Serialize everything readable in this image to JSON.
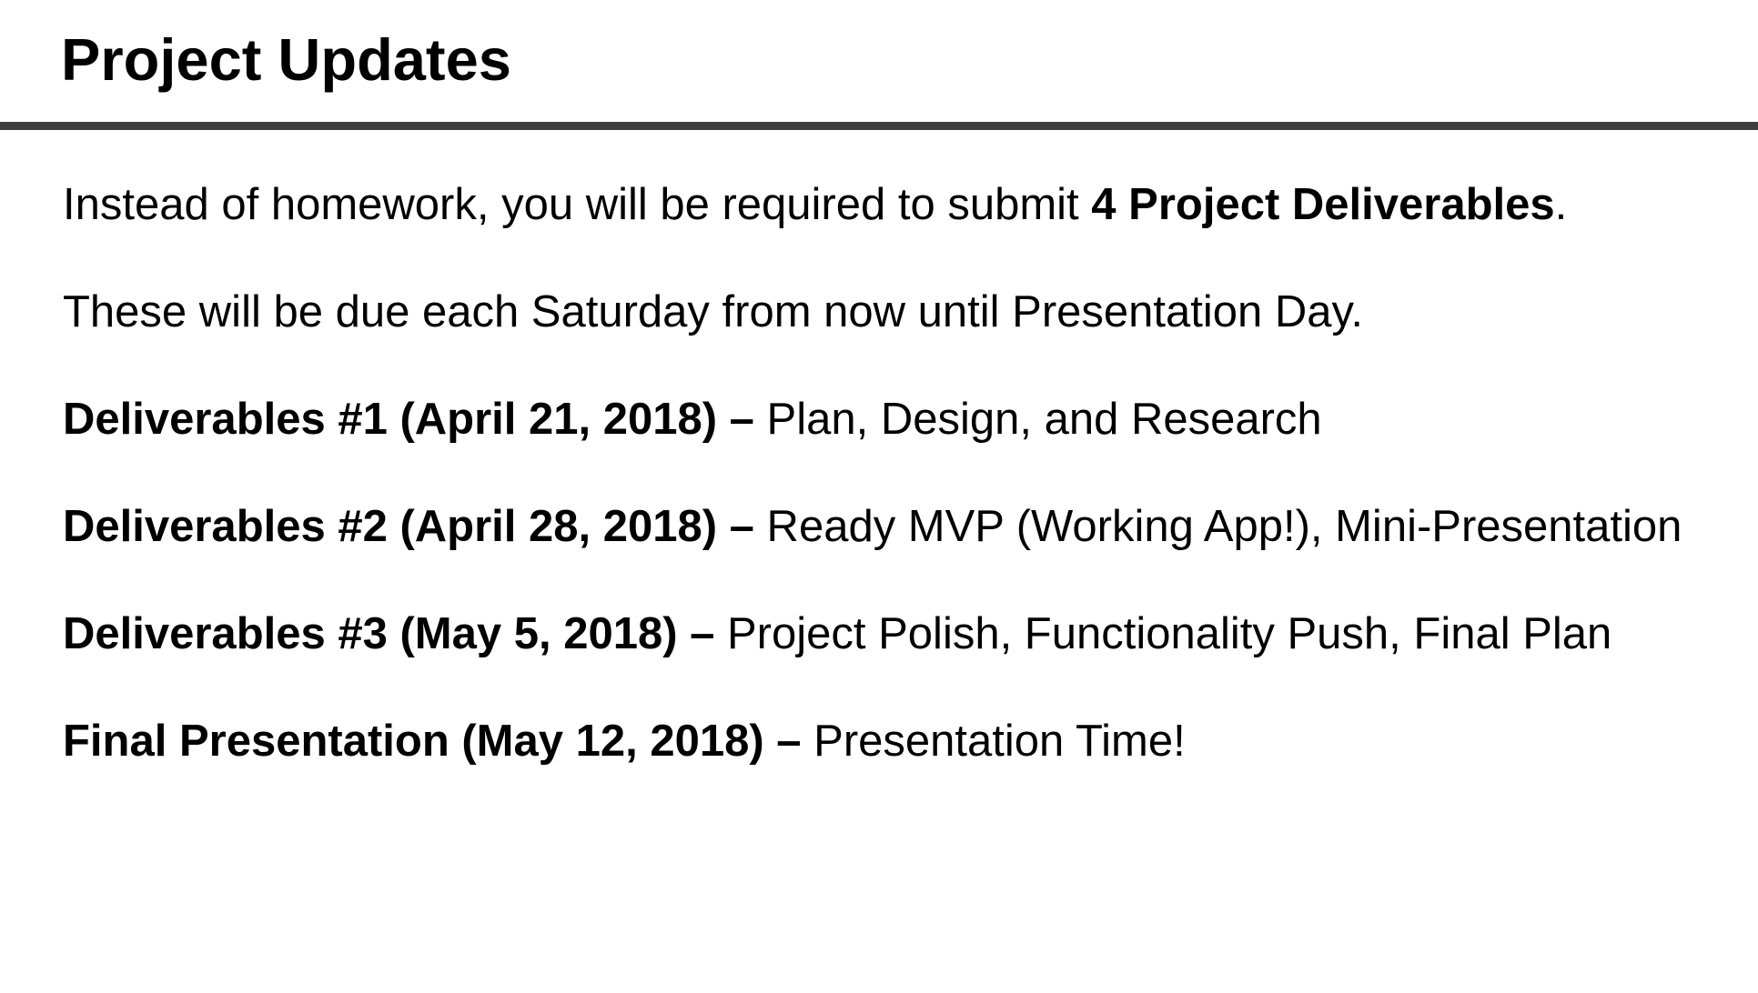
{
  "slide": {
    "title": "Project Updates",
    "intro": {
      "text_before": "Instead of homework, you will be required to submit ",
      "bold": "4 Project Deliverables",
      "text_after": "."
    },
    "schedule_note": "These will be due each Saturday from now until Presentation Day.",
    "deliverables": [
      {
        "heading": "Deliverables #1 (April 21, 2018) –",
        "description": " Plan, Design, and Research"
      },
      {
        "heading": "Deliverables #2 (April 28, 2018) –",
        "description": " Ready MVP (Working App!), Mini-Presentation"
      },
      {
        "heading": "Deliverables #3 (May 5, 2018) –",
        "description": " Project Polish, Functionality Push, Final Plan"
      },
      {
        "heading": "Final Presentation (May 12, 2018) –",
        "description": " Presentation Time!"
      }
    ]
  }
}
